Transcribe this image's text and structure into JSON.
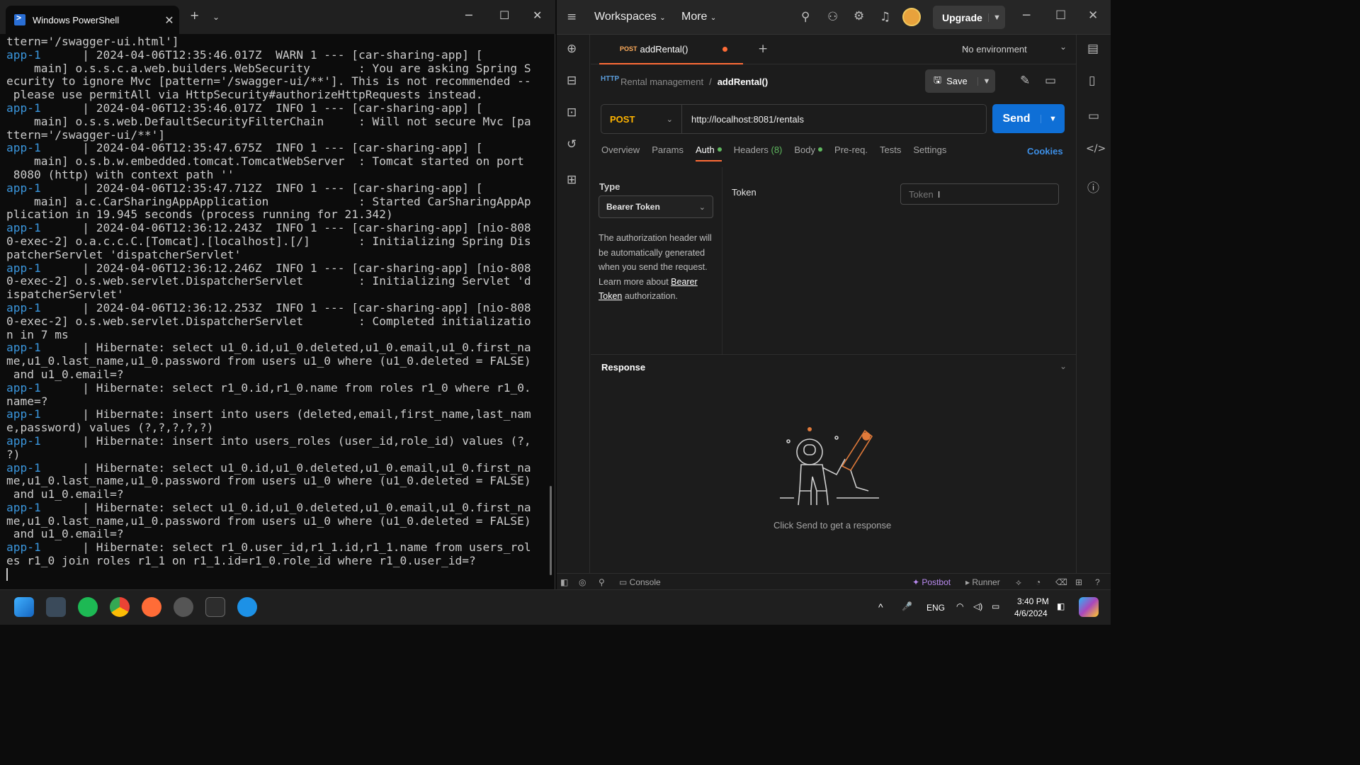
{
  "powershell": {
    "tab_title": "Windows PowerShell",
    "lines": [
      {
        "a": "",
        "t": "ttern='/swagger-ui.html']"
      },
      {
        "a": "app-1",
        "t": "      | 2024-04-06T12:35:46.017Z  WARN 1 --- [car-sharing-app] ["
      },
      {
        "a": "",
        "t": "    main] o.s.s.c.a.web.builders.WebSecurity       : You are asking Spring S"
      },
      {
        "a": "",
        "t": "ecurity to ignore Mvc [pattern='/swagger-ui/**']. This is not recommended --"
      },
      {
        "a": "",
        "t": " please use permitAll via HttpSecurity#authorizeHttpRequests instead."
      },
      {
        "a": "app-1",
        "t": "      | 2024-04-06T12:35:46.017Z  INFO 1 --- [car-sharing-app] ["
      },
      {
        "a": "",
        "t": "    main] o.s.s.web.DefaultSecurityFilterChain     : Will not secure Mvc [pa"
      },
      {
        "a": "",
        "t": "ttern='/swagger-ui/**']"
      },
      {
        "a": "app-1",
        "t": "      | 2024-04-06T12:35:47.675Z  INFO 1 --- [car-sharing-app] ["
      },
      {
        "a": "",
        "t": "    main] o.s.b.w.embedded.tomcat.TomcatWebServer  : Tomcat started on port"
      },
      {
        "a": "",
        "t": " 8080 (http) with context path ''"
      },
      {
        "a": "app-1",
        "t": "      | 2024-04-06T12:35:47.712Z  INFO 1 --- [car-sharing-app] ["
      },
      {
        "a": "",
        "t": "    main] a.c.CarSharingAppApplication             : Started CarSharingAppAp"
      },
      {
        "a": "",
        "t": "plication in 19.945 seconds (process running for 21.342)"
      },
      {
        "a": "app-1",
        "t": "      | 2024-04-06T12:36:12.243Z  INFO 1 --- [car-sharing-app] [nio-808"
      },
      {
        "a": "",
        "t": "0-exec-2] o.a.c.c.C.[Tomcat].[localhost].[/]       : Initializing Spring Dis"
      },
      {
        "a": "",
        "t": "patcherServlet 'dispatcherServlet'"
      },
      {
        "a": "app-1",
        "t": "      | 2024-04-06T12:36:12.246Z  INFO 1 --- [car-sharing-app] [nio-808"
      },
      {
        "a": "",
        "t": "0-exec-2] o.s.web.servlet.DispatcherServlet        : Initializing Servlet 'd"
      },
      {
        "a": "",
        "t": "ispatcherServlet'"
      },
      {
        "a": "app-1",
        "t": "      | 2024-04-06T12:36:12.253Z  INFO 1 --- [car-sharing-app] [nio-808"
      },
      {
        "a": "",
        "t": "0-exec-2] o.s.web.servlet.DispatcherServlet        : Completed initializatio"
      },
      {
        "a": "",
        "t": "n in 7 ms"
      },
      {
        "a": "app-1",
        "t": "      | Hibernate: select u1_0.id,u1_0.deleted,u1_0.email,u1_0.first_na"
      },
      {
        "a": "",
        "t": "me,u1_0.last_name,u1_0.password from users u1_0 where (u1_0.deleted = FALSE)"
      },
      {
        "a": "",
        "t": " and u1_0.email=?"
      },
      {
        "a": "app-1",
        "t": "      | Hibernate: select r1_0.id,r1_0.name from roles r1_0 where r1_0."
      },
      {
        "a": "",
        "t": "name=?"
      },
      {
        "a": "app-1",
        "t": "      | Hibernate: insert into users (deleted,email,first_name,last_nam"
      },
      {
        "a": "",
        "t": "e,password) values (?,?,?,?,?)"
      },
      {
        "a": "app-1",
        "t": "      | Hibernate: insert into users_roles (user_id,role_id) values (?,"
      },
      {
        "a": "",
        "t": "?)"
      },
      {
        "a": "app-1",
        "t": "      | Hibernate: select u1_0.id,u1_0.deleted,u1_0.email,u1_0.first_na"
      },
      {
        "a": "",
        "t": "me,u1_0.last_name,u1_0.password from users u1_0 where (u1_0.deleted = FALSE)"
      },
      {
        "a": "",
        "t": " and u1_0.email=?"
      },
      {
        "a": "app-1",
        "t": "      | Hibernate: select u1_0.id,u1_0.deleted,u1_0.email,u1_0.first_na"
      },
      {
        "a": "",
        "t": "me,u1_0.last_name,u1_0.password from users u1_0 where (u1_0.deleted = FALSE)"
      },
      {
        "a": "",
        "t": " and u1_0.email=?"
      },
      {
        "a": "app-1",
        "t": "      | Hibernate: select r1_0.user_id,r1_1.id,r1_1.name from users_rol"
      },
      {
        "a": "",
        "t": "es r1_0 join roles r1_1 on r1_1.id=r1_0.role_id where r1_0.user_id=?"
      }
    ]
  },
  "postman": {
    "menu": {
      "workspaces": "Workspaces",
      "more": "More",
      "upgrade": "Upgrade"
    },
    "tab": {
      "method": "POST",
      "name": "addRental()"
    },
    "environment": "No environment",
    "breadcrumb": {
      "collection": "Rental management",
      "sep": "/",
      "request": "addRental()"
    },
    "save_label": "Save",
    "request": {
      "method": "POST",
      "url": "http://localhost:8081/rentals"
    },
    "send_label": "Send",
    "subtabs": {
      "overview": "Overview",
      "params": "Params",
      "auth": "Auth",
      "headers": "Headers",
      "headers_count": "(8)",
      "body": "Body",
      "prereq": "Pre-req.",
      "tests": "Tests",
      "settings": "Settings"
    },
    "cookies_label": "Cookies",
    "auth": {
      "type_label": "Type",
      "type_value": "Bearer Token",
      "desc_1": "The authorization header will be automatically generated when you send the request. Learn more about ",
      "desc_link": "Bearer Token",
      "desc_2": " authorization.",
      "token_label": "Token",
      "token_placeholder": "Token"
    },
    "response": {
      "label": "Response",
      "hint": "Click Send to get a response"
    },
    "status": {
      "console": "Console",
      "postbot": "Postbot",
      "runner": "Runner"
    },
    "colors": {
      "accent": "#ff6c37",
      "send": "#0f6fd6",
      "post": "#ffb400"
    }
  },
  "taskbar": {
    "lang": "ENG",
    "time": "3:40 PM",
    "date": "4/6/2024"
  }
}
